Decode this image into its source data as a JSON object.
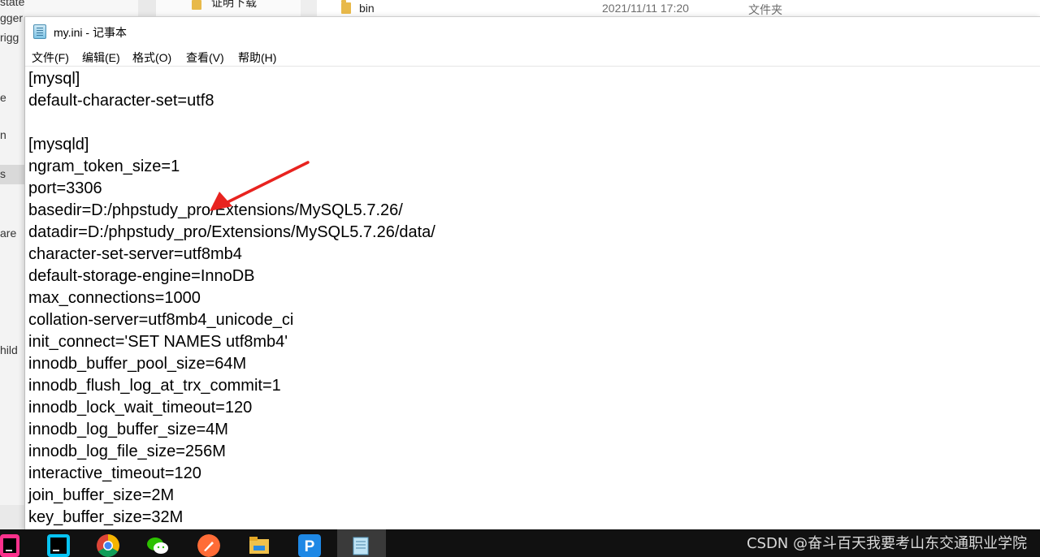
{
  "background": {
    "left_fragments": [
      "state",
      "gger",
      "rigg",
      "e",
      "n",
      "s",
      "are",
      "hild"
    ],
    "explorer_row": {
      "folder_name_left": "证明下载",
      "folder_name": "bin",
      "date": "2021/11/11 17:20",
      "type": "文件夹"
    }
  },
  "notepad": {
    "title": "my.ini - 记事本",
    "menu": [
      "文件(F)",
      "编辑(E)",
      "格式(O)",
      "查看(V)",
      "帮助(H)"
    ],
    "lines": [
      "[mysql]",
      "default-character-set=utf8",
      "",
      "[mysqld]",
      "ngram_token_size=1",
      "port=3306",
      "basedir=D:/phpstudy_pro/Extensions/MySQL5.7.26/",
      "datadir=D:/phpstudy_pro/Extensions/MySQL5.7.26/data/",
      "character-set-server=utf8mb4",
      "default-storage-engine=InnoDB",
      "max_connections=1000",
      "collation-server=utf8mb4_unicode_ci",
      "init_connect='SET NAMES utf8mb4'",
      "innodb_buffer_pool_size=64M",
      "innodb_flush_log_at_trx_commit=1",
      "innodb_lock_wait_timeout=120",
      "innodb_log_buffer_size=4M",
      "innodb_log_file_size=256M",
      "interactive_timeout=120",
      "join_buffer_size=2M",
      "key_buffer_size=32M"
    ],
    "annotation_color": "#e8231f"
  },
  "taskbar": {
    "icons": [
      "intellij-icon",
      "webstorm-icon",
      "chrome-icon",
      "wechat-icon",
      "postman-icon",
      "file-explorer-icon",
      "phpstudy-icon",
      "notepad-icon"
    ],
    "watermark": "CSDN @奋斗百天我要考山东交通职业学院"
  }
}
